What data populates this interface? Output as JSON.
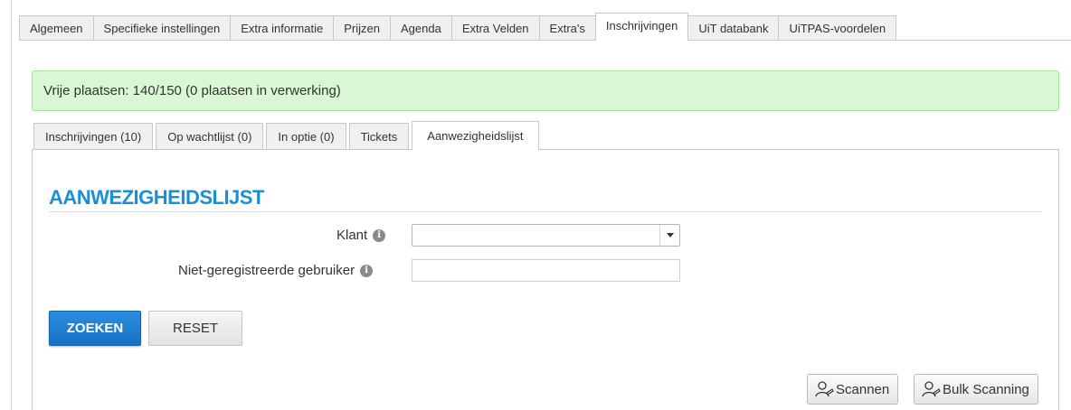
{
  "top_tabs": [
    {
      "label": "Algemeen",
      "active": false
    },
    {
      "label": "Specifieke instellingen",
      "active": false
    },
    {
      "label": "Extra informatie",
      "active": false
    },
    {
      "label": "Prijzen",
      "active": false
    },
    {
      "label": "Agenda",
      "active": false
    },
    {
      "label": "Extra Velden",
      "active": false
    },
    {
      "label": "Extra's",
      "active": false
    },
    {
      "label": "Inschrijvingen",
      "active": true
    },
    {
      "label": "UiT databank",
      "active": false
    },
    {
      "label": "UiTPAS-voordelen",
      "active": false
    }
  ],
  "alert": {
    "text": "Vrije plaatsen: 140/150 (0 plaatsen in verwerking)",
    "color": "#d9f7d4"
  },
  "sub_tabs": [
    {
      "label": "Inschrijvingen (10)",
      "active": false
    },
    {
      "label": "Op wachtlijst (0)",
      "active": false
    },
    {
      "label": "In optie (0)",
      "active": false
    },
    {
      "label": "Tickets",
      "active": false
    },
    {
      "label": "Aanwezigheidslijst",
      "active": true
    }
  ],
  "panel": {
    "title": "AANWEZIGHEIDSLIJST",
    "title_color": "#1b8fd6"
  },
  "form": {
    "klant_label": "Klant",
    "klant_value": "",
    "unregistered_label": "Niet-geregistreerde gebruiker",
    "unregistered_value": "",
    "info_icon": "info-icon"
  },
  "buttons": {
    "search": "ZOEKEN",
    "reset": "RESET",
    "scan": "Scannen",
    "bulk_scan": "Bulk Scanning",
    "primary_color": "#1670c4"
  }
}
